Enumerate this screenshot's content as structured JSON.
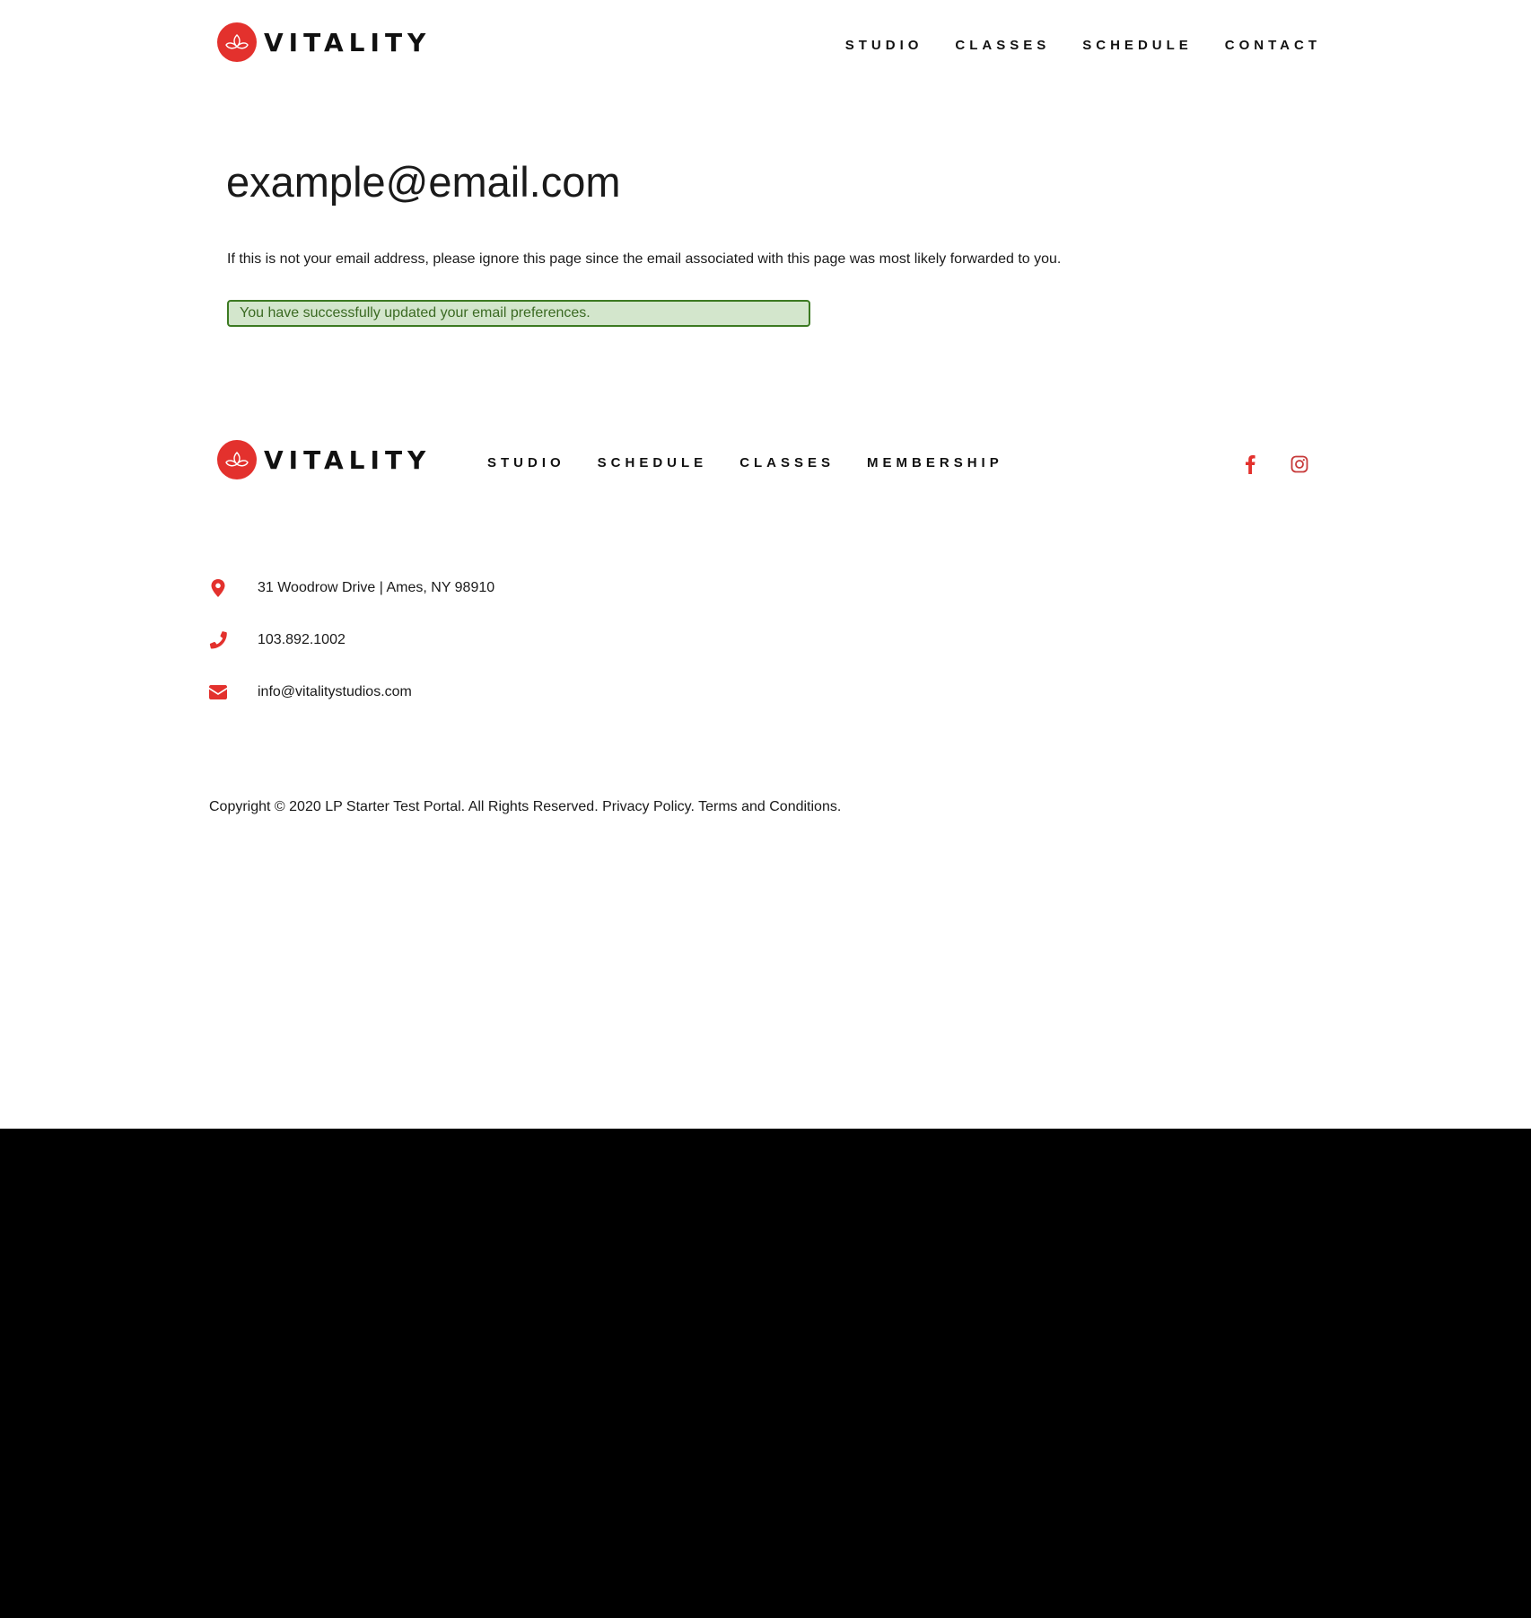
{
  "brand": {
    "name": "VITALITY",
    "logo_icon": "lotus-icon",
    "accent_color": "#e3312d"
  },
  "header": {
    "nav": [
      {
        "label": "STUDIO"
      },
      {
        "label": "CLASSES"
      },
      {
        "label": "SCHEDULE"
      },
      {
        "label": "CONTACT"
      }
    ]
  },
  "main": {
    "email": "example@email.com",
    "notice": "If this is not your email address, please ignore this page since the email associated with this page was most likely forwarded to you.",
    "success_message": "You have successfully updated your email preferences.",
    "success_bg_color": "#d3e6cc",
    "success_border_color": "#3c7a22"
  },
  "footer": {
    "nav": [
      {
        "label": "STUDIO"
      },
      {
        "label": "SCHEDULE"
      },
      {
        "label": "CLASSES"
      },
      {
        "label": "MEMBERSHIP"
      }
    ],
    "social": [
      {
        "name": "facebook-icon"
      },
      {
        "name": "instagram-icon"
      }
    ],
    "contact": {
      "address": "31 Woodrow Drive | Ames, NY 98910",
      "phone": "103.892.1002",
      "email": "info@vitalitystudios.com"
    },
    "copyright": {
      "text": "Copyright © 2020 LP Starter Test Portal. All Rights Reserved.",
      "privacy_link": "Privacy Policy.",
      "terms_link": "Terms and Conditions."
    }
  }
}
